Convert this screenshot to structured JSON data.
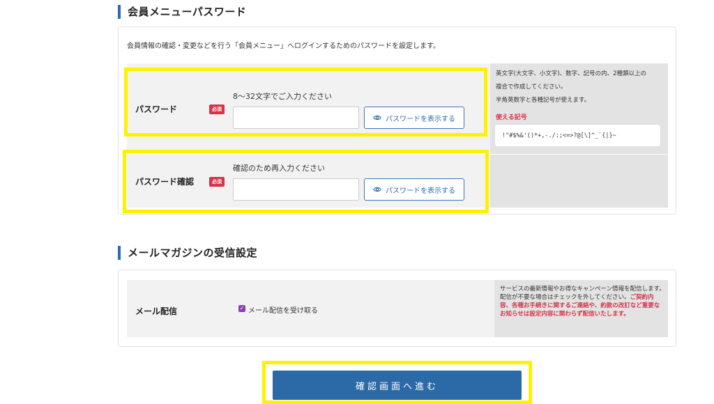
{
  "password_section": {
    "title": "会員メニューパスワード",
    "intro": "会員情報の確認・変更などを行う「会員メニュー」へログインするためのパスワードを設定します。",
    "password": {
      "label": "パスワード",
      "required": "必須",
      "hint": "8～32文字でご入力ください",
      "value": "",
      "show_button": "パスワードを表示する"
    },
    "password_confirm": {
      "label": "パスワード確認",
      "required": "必須",
      "hint": "確認のため再入力ください",
      "value": "",
      "show_button": "パスワードを表示する"
    },
    "rules": {
      "line1": "英文字(大文字、小文字)、数字、記号の内、2種類以上の",
      "line2": "複合で作成してください。",
      "line3": "半角英数字と各種記号が使えます。",
      "symbols_label": "使える記号",
      "symbols": "!\"#$%&'()*+,-./:;<=>?@[\\]^_`{|}~"
    }
  },
  "mail_section": {
    "title": "メールマガジンの受信設定",
    "label": "メール配信",
    "checkbox_label": "メール配信を受け取る",
    "checked": true,
    "note_normal": "サービスの最新情報やお得なキャンペーン情報を配信します。配信が不要な場合はチェックを外してください。",
    "note_red": "ご契約内容、各種お手続きに関するご連絡や、約款の改訂など重要なお知らせは設定内容に関わらず配信いたします。"
  },
  "submit_button": "確認画面へ進む",
  "colors": {
    "accent": "#2b6cb0",
    "required": "#d6334a",
    "highlight": "#fff200",
    "submit": "#2b6aa6"
  },
  "icons": {
    "show_password": "eye-icon",
    "checkbox": "checkmark-icon"
  }
}
